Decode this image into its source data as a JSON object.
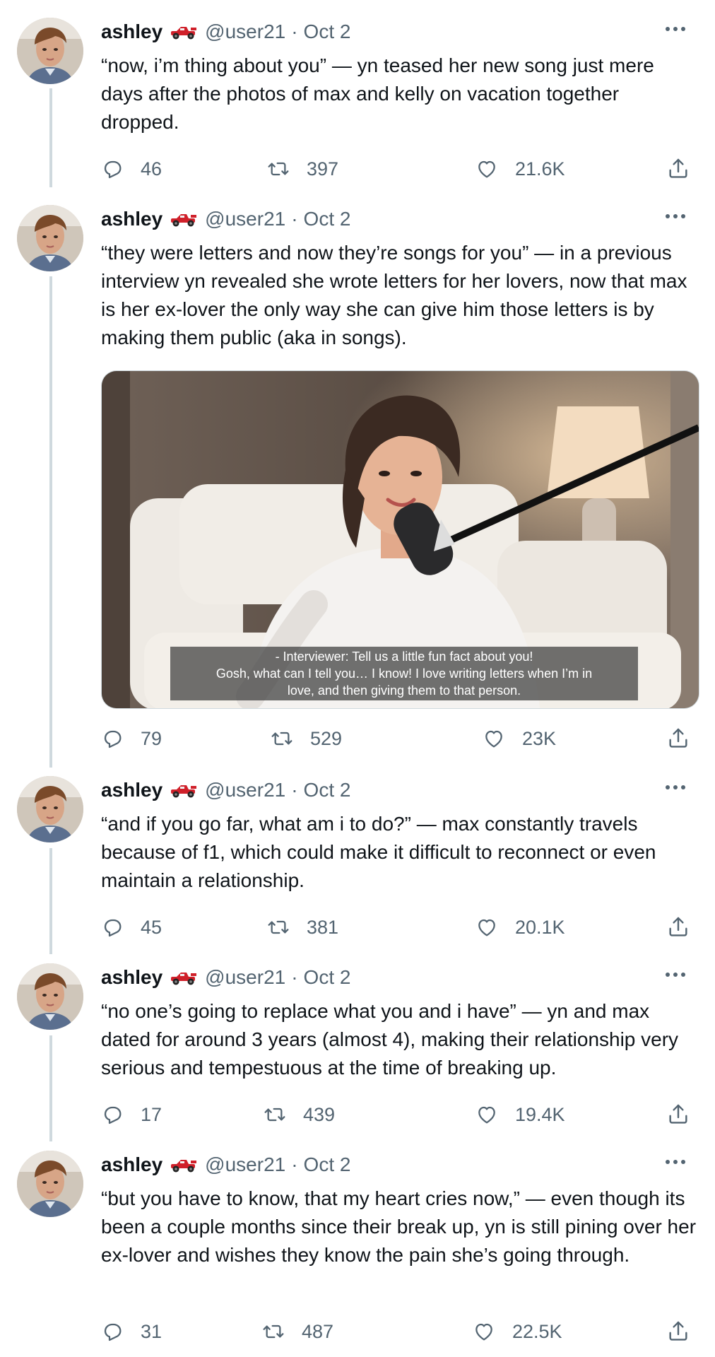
{
  "colors": {
    "text": "#0f1419",
    "secondary": "#536471",
    "line": "#cfd9de"
  },
  "tweets": [
    {
      "name": "ashley",
      "handle": "@user21",
      "date": "Oct 2",
      "text": "“now, i’m thing about you” — yn teased her new song just mere days after the photos of max and kelly on vacation together dropped.",
      "replies": "46",
      "retweets": "397",
      "likes": "21.6K"
    },
    {
      "name": "ashley",
      "handle": "@user21",
      "date": "Oct 2",
      "text": "“they were letters and now they’re songs for you” — in a previous interview yn revealed she wrote letters for her lovers, now that max is her ex-lover the only way she can give him those letters is by making them public (aka in songs).",
      "media_caption": [
        "- Interviewer: Tell us a little fun fact about you!",
        "Gosh, what can I tell you… I know! I love writing letters when I’m in",
        "love, and then giving them to that person."
      ],
      "replies": "79",
      "retweets": "529",
      "likes": "23K"
    },
    {
      "name": "ashley",
      "handle": "@user21",
      "date": "Oct 2",
      "text": "“and if you go far, what am i to do?” — max constantly travels because of f1, which could make it difficult to reconnect or even maintain a relationship.",
      "replies": "45",
      "retweets": "381",
      "likes": "20.1K"
    },
    {
      "name": "ashley",
      "handle": "@user21",
      "date": "Oct 2",
      "text": "“no one’s going to replace what you and i have” — yn and max dated for around 3 years (almost 4), making their relationship very serious and tempestuous at the time of breaking up.",
      "replies": "17",
      "retweets": "439",
      "likes": "19.4K"
    },
    {
      "name": "ashley",
      "handle": "@user21",
      "date": "Oct 2",
      "text": "“but you have to know, that my heart cries now,” — even though its been a couple months since their break up, yn is still pining over her ex-lover and wishes they know the pain she’s going through.",
      "replies": "31",
      "retweets": "487",
      "likes": "22.5K"
    }
  ]
}
